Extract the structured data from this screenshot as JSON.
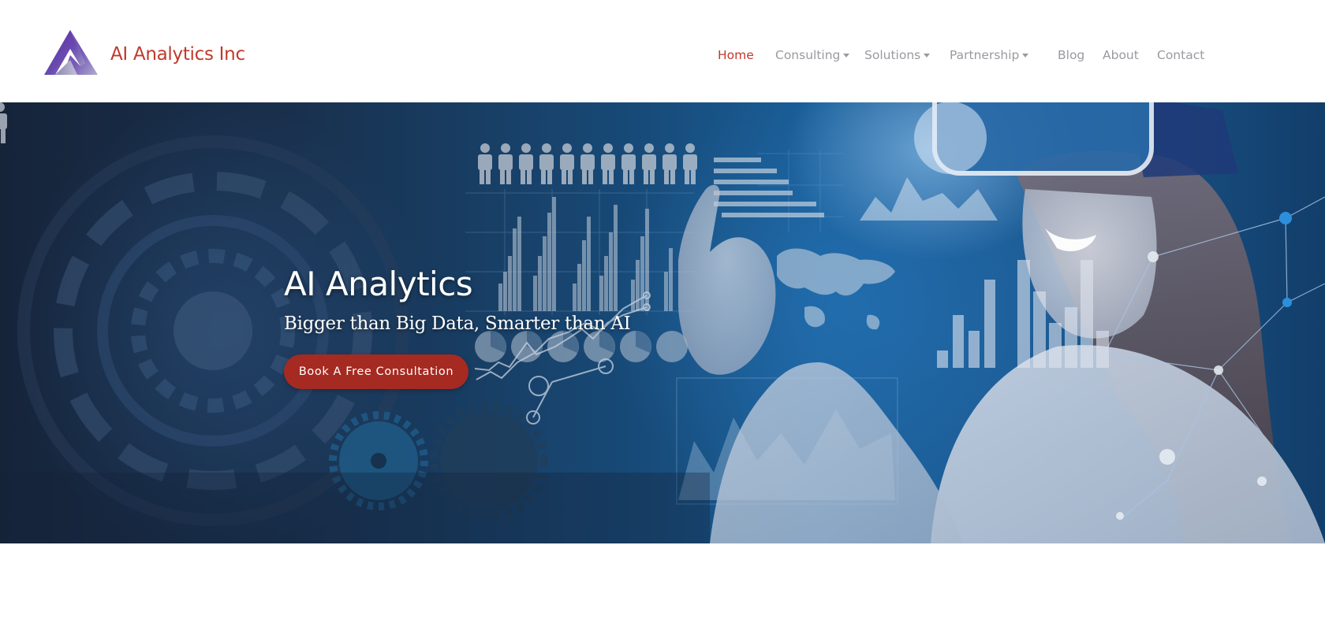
{
  "header": {
    "brand_name": "AI Analytics Inc",
    "logo_icon": "triangle-a-logo-icon"
  },
  "nav": {
    "items": [
      {
        "label": "Home",
        "active": true,
        "dropdown": false
      },
      {
        "label": "Consulting",
        "active": false,
        "dropdown": true
      },
      {
        "label": "Solutions",
        "active": false,
        "dropdown": true
      },
      {
        "label": "Partnership",
        "active": false,
        "dropdown": true
      },
      {
        "label": "Blog",
        "active": false,
        "dropdown": false
      },
      {
        "label": "About",
        "active": false,
        "dropdown": false
      },
      {
        "label": "Contact",
        "active": false,
        "dropdown": false
      }
    ]
  },
  "hero": {
    "title": "AI Analytics",
    "subtitle": "Bigger than Big Data, Smarter than AI",
    "cta_label": "Book A Free Consultation",
    "background_description": "woman-wearing-vr-headset-with-data-visualizations"
  },
  "colors": {
    "brand": "#c0392b",
    "nav_text": "#9a9aa0",
    "cta_background": "#a52a21",
    "hero_dark": "#16243a",
    "hero_blue": "#1a5f99"
  }
}
